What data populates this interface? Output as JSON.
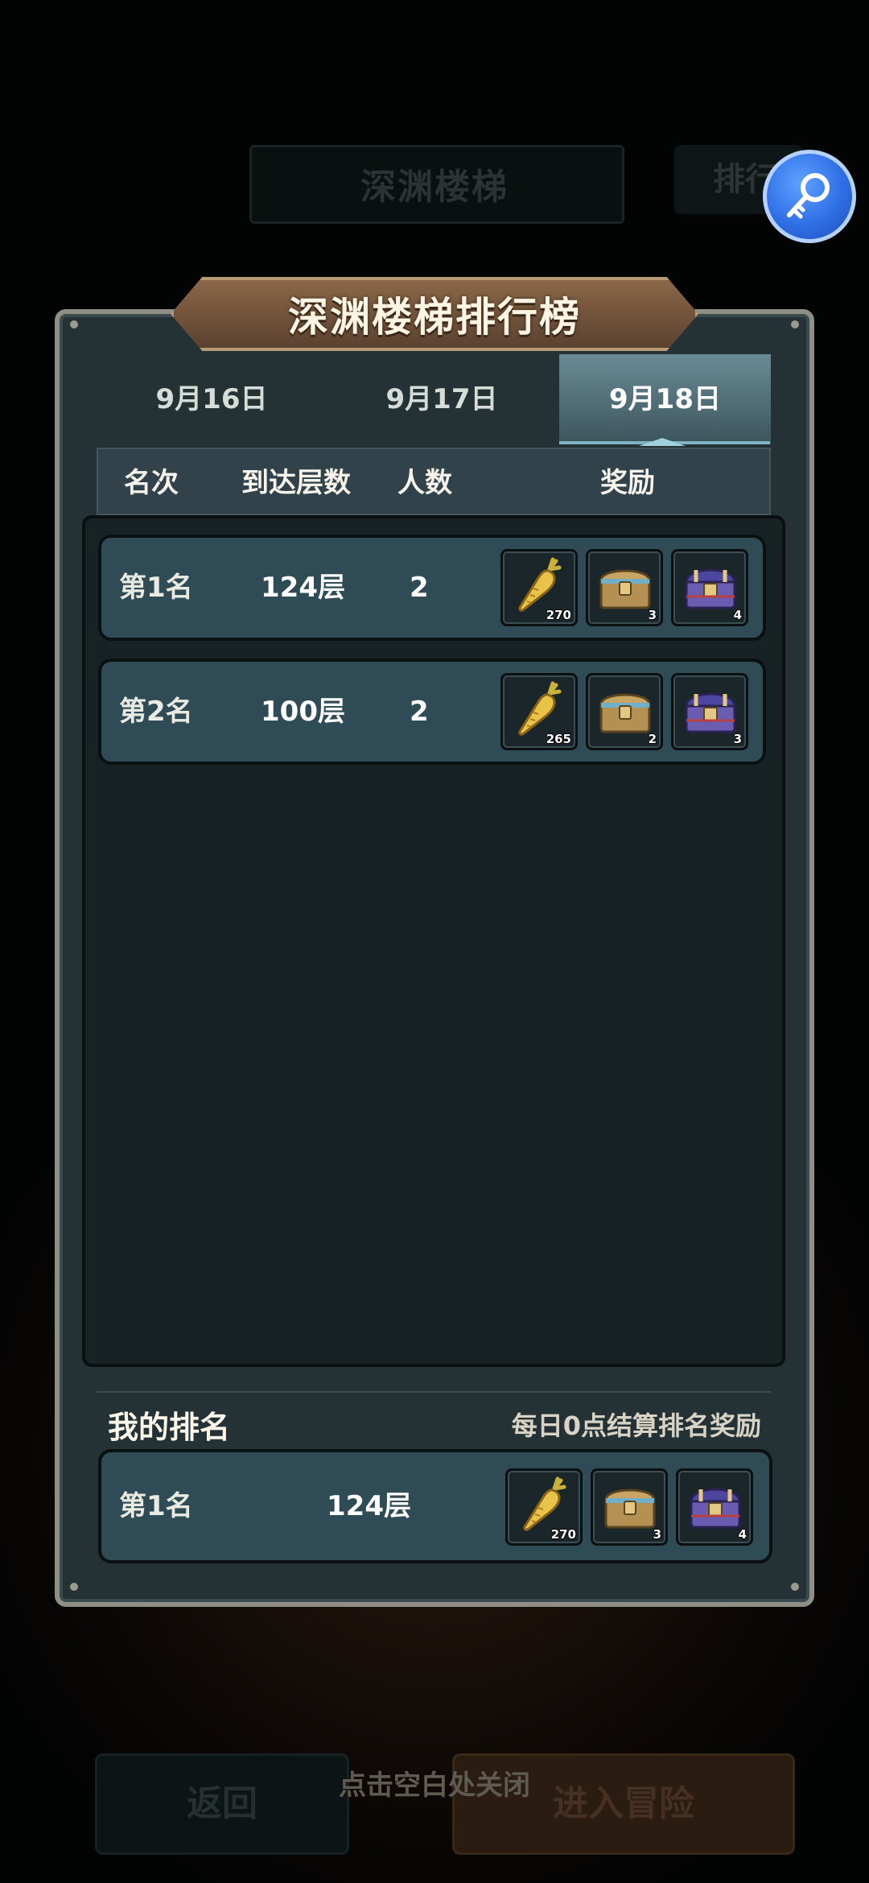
{
  "background": {
    "title": "深渊楼梯",
    "rank_button": "排行",
    "close_hint": "点击空白处关闭",
    "back_button": "返回",
    "enter_button": "进入冒险"
  },
  "panel": {
    "title": "深渊楼梯排行榜",
    "tabs": [
      {
        "label": "9月16日",
        "active": false
      },
      {
        "label": "9月17日",
        "active": false
      },
      {
        "label": "9月18日",
        "active": true
      }
    ],
    "columns": {
      "rank": "名次",
      "floor": "到达层数",
      "count": "人数",
      "reward": "奖励"
    },
    "rows": [
      {
        "rank": "第1名",
        "floor": "124层",
        "count": "2",
        "rewards": [
          {
            "icon": "carrot-icon",
            "qty": "270"
          },
          {
            "icon": "gold-chest-icon",
            "qty": "3"
          },
          {
            "icon": "purple-chest-icon",
            "qty": "4"
          }
        ]
      },
      {
        "rank": "第2名",
        "floor": "100层",
        "count": "2",
        "rewards": [
          {
            "icon": "carrot-icon",
            "qty": "265"
          },
          {
            "icon": "gold-chest-icon",
            "qty": "2"
          },
          {
            "icon": "purple-chest-icon",
            "qty": "3"
          }
        ]
      }
    ],
    "my_rank": {
      "label": "我的排名",
      "note": "每日0点结算排名奖励",
      "rank": "第1名",
      "floor": "124层",
      "rewards": [
        {
          "icon": "carrot-icon",
          "qty": "270"
        },
        {
          "icon": "gold-chest-icon",
          "qty": "3"
        },
        {
          "icon": "purple-chest-icon",
          "qty": "4"
        }
      ]
    }
  },
  "colors": {
    "accent_blue": "#2f6fe6",
    "panel": "#243236",
    "row": "#2f4b55",
    "title_plate": "#7a5a3f"
  },
  "icons": [
    "search-key-icon",
    "carrot-icon",
    "gold-chest-icon",
    "purple-chest-icon"
  ]
}
